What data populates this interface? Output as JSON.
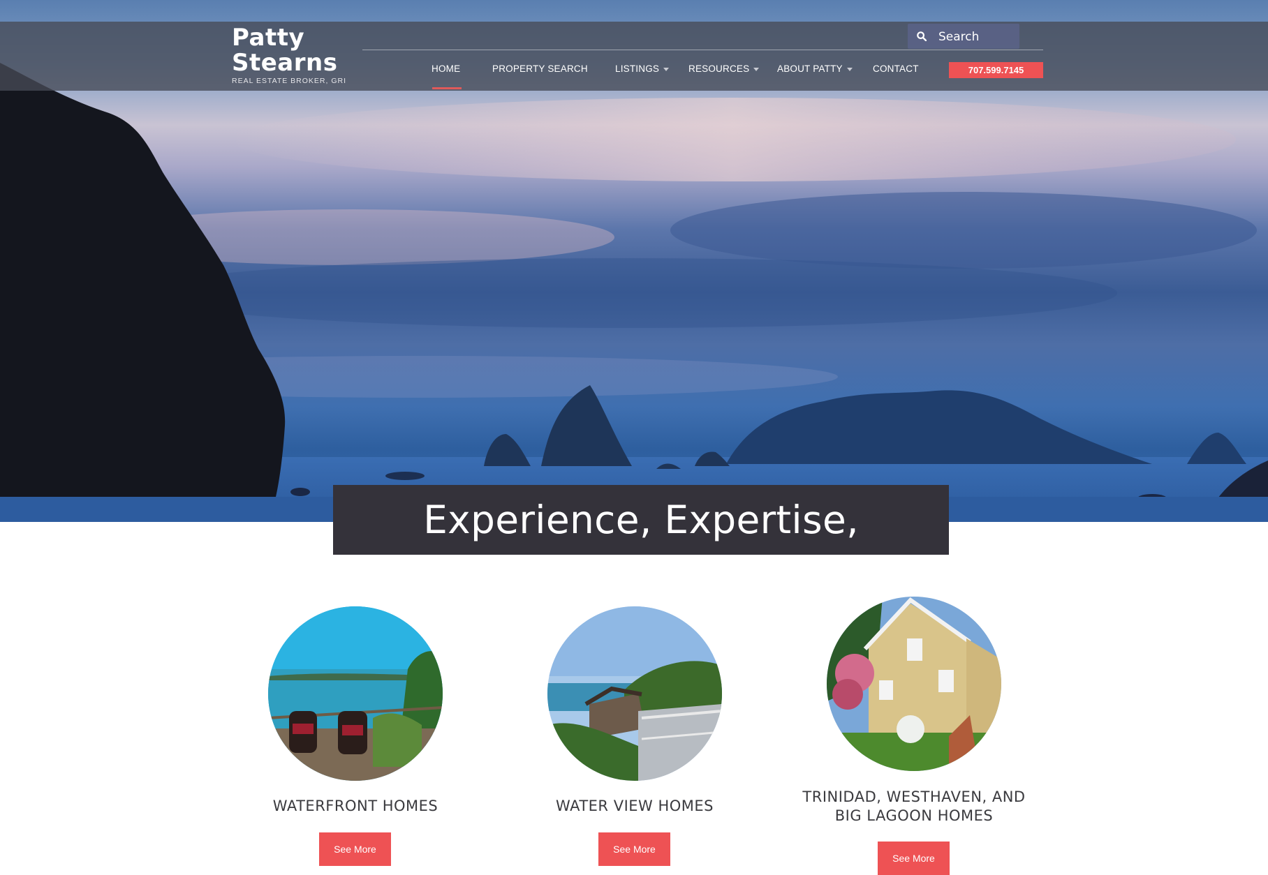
{
  "brand": {
    "name_line1": "Patty",
    "name_line2": "Stearns",
    "subtitle": "REAL ESTATE BROKER, GRI"
  },
  "search": {
    "placeholder": "Search",
    "icon": "search-icon"
  },
  "nav": {
    "items": [
      {
        "label": "HOME",
        "active": true,
        "dropdown": false
      },
      {
        "label": "PROPERTY SEARCH",
        "dropdown": false
      },
      {
        "label": "LISTINGS",
        "dropdown": true
      },
      {
        "label": "RESOURCES",
        "dropdown": true
      },
      {
        "label": "ABOUT PATTY",
        "dropdown": true
      },
      {
        "label": "CONTACT",
        "dropdown": false
      }
    ],
    "phone": "707.599.7145"
  },
  "hero": {
    "tagline": "Experience, Expertise, Excellence"
  },
  "categories": [
    {
      "title": "WATERFRONT HOMES",
      "button": "See More"
    },
    {
      "title": "WATER VIEW HOMES",
      "button": "See More"
    },
    {
      "title_line1": "TRINIDAD, WESTHAVEN, AND",
      "title_line2": "BIG LAGOON HOMES",
      "button": "See More"
    }
  ],
  "colors": {
    "accent": "#ee5254",
    "header_bar": "#464a56",
    "tagline_bg": "#34323a"
  }
}
